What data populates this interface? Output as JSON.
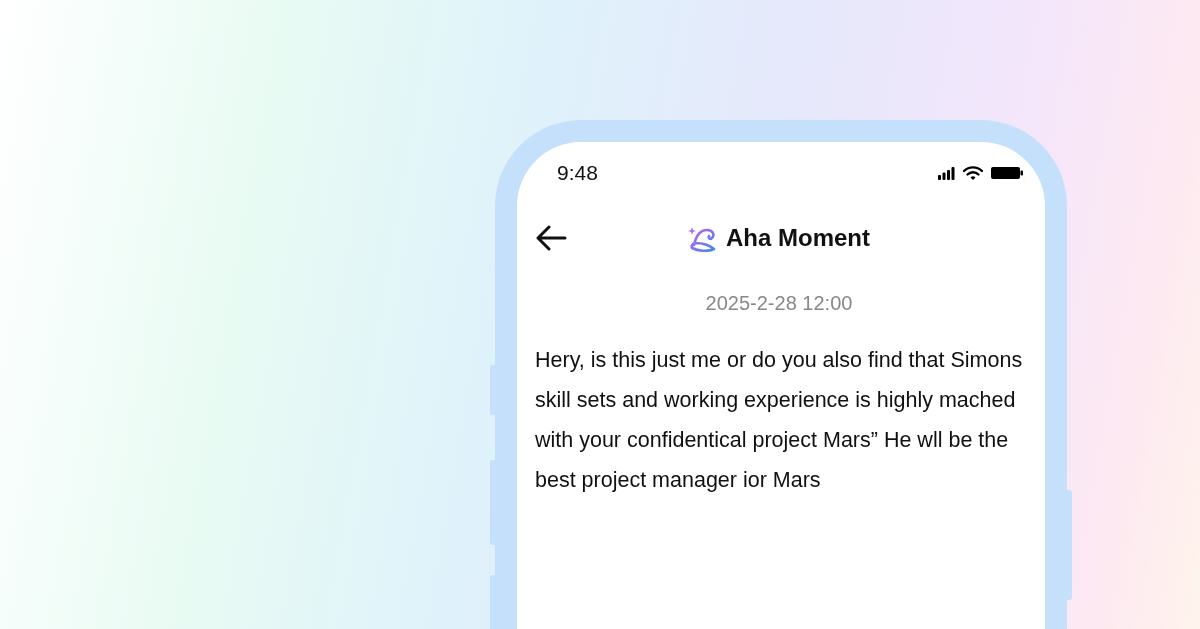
{
  "status_bar": {
    "time": "9:48"
  },
  "header": {
    "title": "Aha Moment"
  },
  "message": {
    "timestamp": "2025-2-28 12:00",
    "text": "Hery, is this just me or do you also find that Simons skill sets and working experience is highly mached with your confidentical project Mars” He wll be the best project manager ior Mars"
  }
}
